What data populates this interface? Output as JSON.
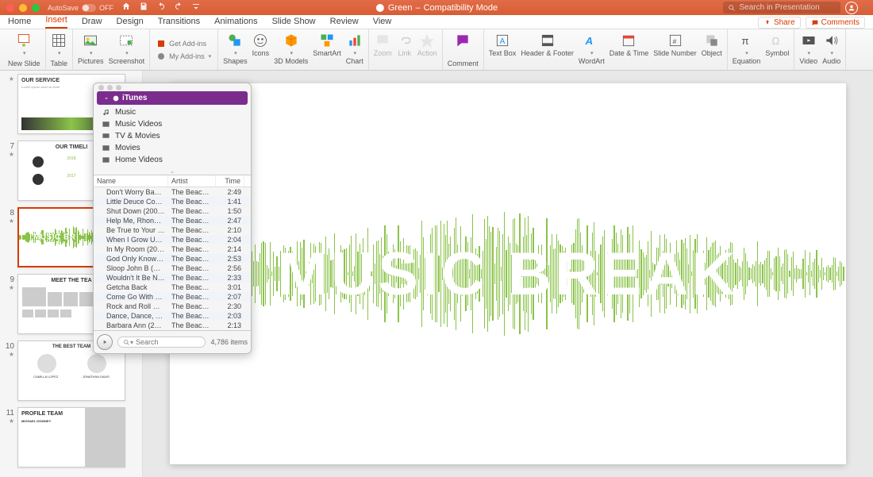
{
  "titlebar": {
    "autosave": "AutoSave",
    "autosave_state": "OFF",
    "doc_title": "Green",
    "doc_mode": "Compatibility Mode",
    "search_placeholder": "Search in Presentation"
  },
  "tabs": {
    "items": [
      "Home",
      "Insert",
      "Draw",
      "Design",
      "Transitions",
      "Animations",
      "Slide Show",
      "Review",
      "View"
    ],
    "active_index": 1,
    "share": "Share",
    "comments": "Comments"
  },
  "ribbon": {
    "new_slide": "New\nSlide",
    "table": "Table",
    "pictures": "Pictures",
    "screenshot": "Screenshot",
    "get_addins": "Get Add-ins",
    "my_addins": "My Add-ins",
    "shapes": "Shapes",
    "icons": "Icons",
    "models": "3D\nModels",
    "smartart": "SmartArt",
    "chart": "Chart",
    "zoom": "Zoom",
    "link": "Link",
    "action": "Action",
    "comment": "Comment",
    "textbox": "Text\nBox",
    "headerfooter": "Header &\nFooter",
    "wordart": "WordArt",
    "datetime": "Date &\nTime",
    "slidenum": "Slide\nNumber",
    "object": "Object",
    "equation": "Equation",
    "symbol": "Symbol",
    "video": "Video",
    "audio": "Audio"
  },
  "slide": {
    "text": "MUSIC BREAK"
  },
  "thumbs": {
    "items": [
      {
        "num": "",
        "title": "OUR SERVICE"
      },
      {
        "num": "7",
        "title": "OUR TIMELI"
      },
      {
        "num": "8",
        "title": "MUSIC BR",
        "selected": true
      },
      {
        "num": "9",
        "title": "MEET THE TEA"
      },
      {
        "num": "10",
        "title": "THE BEST TEAM"
      },
      {
        "num": "11",
        "title": "PROFILE TEAM"
      }
    ]
  },
  "media": {
    "category": "iTunes",
    "list": [
      "Music",
      "Music Videos",
      "TV & Movies",
      "Movies",
      "Home Videos"
    ],
    "headers": {
      "name": "Name",
      "artist": "Artist",
      "time": "Time"
    },
    "rows": [
      {
        "name": "Don't Worry Baby...",
        "artist": "The Beach B...",
        "time": "2:49"
      },
      {
        "name": "Little Deuce Coup...",
        "artist": "The Beach B...",
        "time": "1:41"
      },
      {
        "name": "Shut Down (2003...",
        "artist": "The Beach B...",
        "time": "1:50"
      },
      {
        "name": "Help Me, Rhonda (...",
        "artist": "The Beach B...",
        "time": "2:47"
      },
      {
        "name": "Be True to Your Sc...",
        "artist": "The Beach B...",
        "time": "2:10"
      },
      {
        "name": "When I Grow Up (...",
        "artist": "The Beach B...",
        "time": "2:04"
      },
      {
        "name": "In My Room (2001...",
        "artist": "The Beach B...",
        "time": "2:14"
      },
      {
        "name": "God Only Knows (...",
        "artist": "The Beach B...",
        "time": "2:53"
      },
      {
        "name": "Sloop John B (Sin...",
        "artist": "The Beach B...",
        "time": "2:56"
      },
      {
        "name": "Wouldn't It Be Nic...",
        "artist": "The Beach B...",
        "time": "2:33"
      },
      {
        "name": "Getcha Back",
        "artist": "The Beach B...",
        "time": "3:01"
      },
      {
        "name": "Come Go With Me",
        "artist": "The Beach B...",
        "time": "2:07"
      },
      {
        "name": "Rock and Roll Music",
        "artist": "The Beach B...",
        "time": "2:30"
      },
      {
        "name": "Dance, Dance, Da...",
        "artist": "The Beach B...",
        "time": "2:03"
      },
      {
        "name": "Barbara Ann (200...",
        "artist": "The Beach B...",
        "time": "2:13"
      }
    ],
    "search_placeholder": "Search",
    "count": "4,786 items"
  }
}
